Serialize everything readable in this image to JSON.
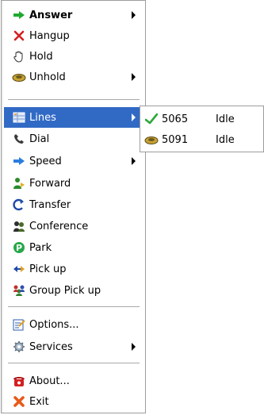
{
  "menu": {
    "items": [
      {
        "label": "Answer",
        "icon": "answer-arrow-icon"
      },
      {
        "label": "Hangup",
        "icon": "hangup-x-icon"
      },
      {
        "label": "Hold",
        "icon": "hold-hand-icon"
      },
      {
        "label": "Unhold",
        "icon": "unhold-handset-icon"
      },
      {
        "label": "Lines",
        "icon": "lines-grid-icon"
      },
      {
        "label": "Dial",
        "icon": "dial-handset-icon"
      },
      {
        "label": "Speed",
        "icon": "speed-arrow-icon"
      },
      {
        "label": "Forward",
        "icon": "forward-person-icon"
      },
      {
        "label": "Transfer",
        "icon": "transfer-arrow-icon"
      },
      {
        "label": "Conference",
        "icon": "conference-people-icon"
      },
      {
        "label": "Park",
        "icon": "park-p-icon"
      },
      {
        "label": "Pick up",
        "icon": "pickup-arrows-icon"
      },
      {
        "label": "Group Pick up",
        "icon": "group-pickup-icon"
      },
      {
        "label": "Options...",
        "icon": "options-icon"
      },
      {
        "label": "Services",
        "icon": "services-gear-icon"
      },
      {
        "label": "About...",
        "icon": "about-phone-icon"
      },
      {
        "label": "Exit",
        "icon": "exit-x-icon"
      }
    ]
  },
  "lines_submenu": {
    "items": [
      {
        "number": "5065",
        "status": "Idle",
        "icon": "checkmark-icon"
      },
      {
        "number": "5091",
        "status": "Idle",
        "icon": "handset-icon"
      }
    ]
  },
  "colors": {
    "highlight": "#316ac5",
    "answer_green": "#1faa2e",
    "hangup_red": "#d42020"
  }
}
